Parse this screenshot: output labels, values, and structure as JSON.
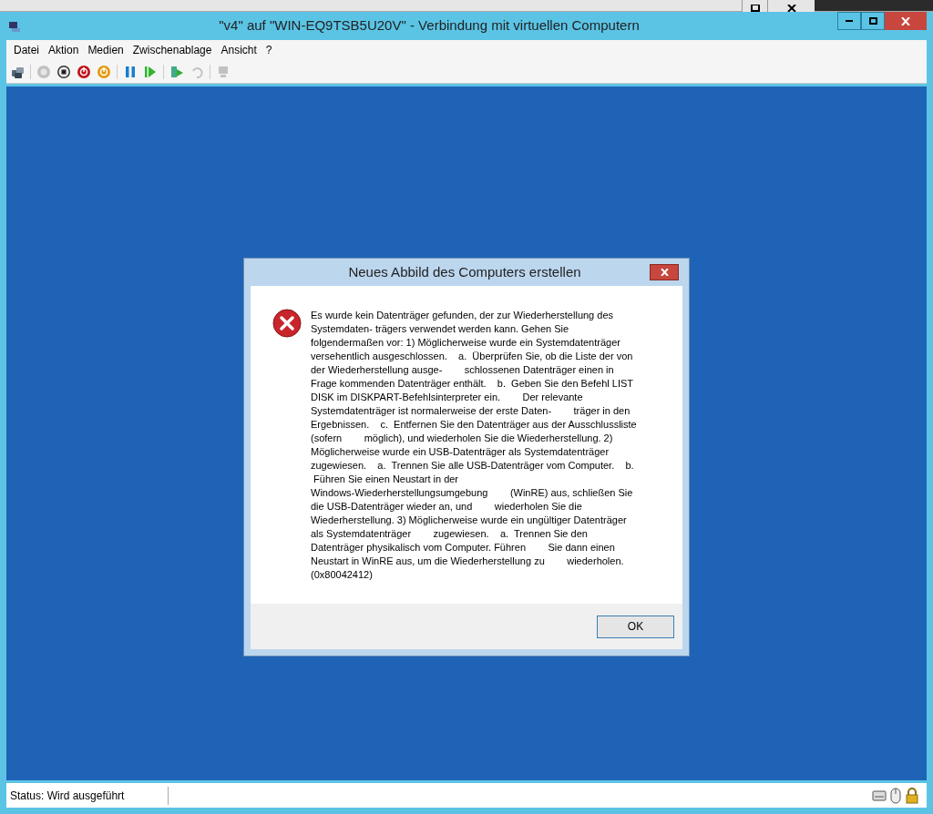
{
  "window": {
    "title": "\"v4\" auf \"WIN-EQ9TSB5U20V\" - Verbindung mit virtuellen Computern"
  },
  "menu": [
    "Datei",
    "Aktion",
    "Medien",
    "Zwischenablage",
    "Ansicht",
    "?"
  ],
  "toolbar": [
    {
      "kind": "ctrl-alt-del",
      "disabled": false
    },
    {
      "kind": "start",
      "disabled": true
    },
    {
      "kind": "stop",
      "disabled": false
    },
    {
      "kind": "shutdown",
      "disabled": false
    },
    {
      "kind": "save",
      "disabled": false
    },
    {
      "kind": "pause",
      "disabled": false
    },
    {
      "kind": "resume",
      "disabled": false
    },
    {
      "kind": "checkpoint",
      "disabled": false
    },
    {
      "kind": "revert",
      "disabled": true
    },
    {
      "kind": "session",
      "disabled": true
    }
  ],
  "dialog": {
    "title": "Neues Abbild des Computers erstellen",
    "message_lines": [
      "Es wurde kein Datenträger gefunden, der zur Wiederherstellung des",
      "Systemdaten- trägers verwendet werden kann. Gehen Sie",
      "folgendermaßen vor: 1) Möglicherweise wurde ein Systemdatenträger",
      "versehentlich ausgeschlossen.    a.  Überprüfen Sie, ob die Liste der von",
      "der Wiederherstellung ausge-        schlossenen Datenträger einen in",
      "Frage kommenden Datenträger enthält.    b.  Geben Sie den Befehl LIST",
      "DISK im DISKPART-Befehlsinterpreter ein.        Der relevante",
      "Systemdatenträger ist normalerweise der erste Daten-        träger in den",
      "Ergebnissen.    c.  Entfernen Sie den Datenträger aus der Ausschlussliste",
      "(sofern        möglich), und wiederholen Sie die Wiederherstellung. 2)",
      "Möglicherweise wurde ein USB-Datenträger als Systemdatenträger",
      "zugewiesen.    a.  Trennen Sie alle USB-Datenträger vom Computer.    b.",
      " Führen Sie einen Neustart in der",
      "Windows-Wiederherstellungsumgebung        (WinRE) aus, schließen Sie",
      "die USB-Datenträger wieder an, und        wiederholen Sie die",
      "Wiederherstellung. 3) Möglicherweise wurde ein ungültiger Datenträger",
      "als Systemdatenträger        zugewiesen.    a.  Trennen Sie den",
      "Datenträger physikalisch vom Computer. Führen        Sie dann einen",
      "Neustart in WinRE aus, um die Wiederherstellung zu        wiederholen.",
      "(0x80042412)"
    ],
    "button": "OK"
  },
  "status_bar": {
    "text": "Status: Wird ausgeführt"
  }
}
